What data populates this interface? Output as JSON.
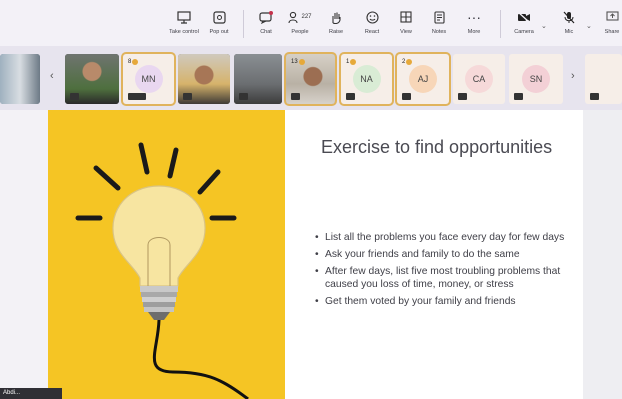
{
  "toolbar": {
    "take_control": "Take control",
    "pop_out": "Pop out",
    "chat": "Chat",
    "people": "People",
    "people_count": "227",
    "raise": "Raise",
    "react": "React",
    "view": "View",
    "notes": "Notes",
    "more": "More",
    "camera": "Camera",
    "mic": "Mic",
    "share": "Share"
  },
  "participants": [
    {
      "initials": "MN",
      "hand": "8"
    },
    {
      "initials": "",
      "hand": "13"
    },
    {
      "initials": "NA",
      "hand": "1"
    },
    {
      "initials": "AJ",
      "hand": "2"
    },
    {
      "initials": "CA",
      "hand": ""
    },
    {
      "initials": "SN",
      "hand": ""
    }
  ],
  "slide": {
    "title": "Exercise to find opportunities",
    "bullets": [
      "List all the problems you face every day for few days",
      "Ask your friends and family to do the same",
      "After few days, list five most troubling problems that caused you loss of time, money, or stress",
      "Get them voted by your family and friends"
    ]
  },
  "presenter_label": "Abdi..."
}
